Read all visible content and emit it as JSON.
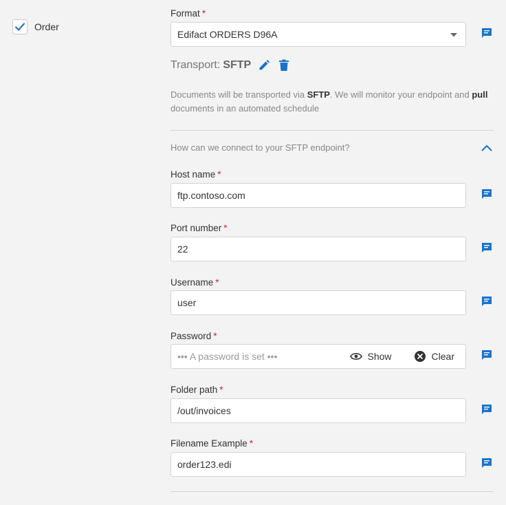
{
  "order": {
    "label": "Order",
    "checked": true
  },
  "format": {
    "label": "Format",
    "value": "Edifact ORDERS D96A"
  },
  "transport": {
    "prefix": "Transport:",
    "type": "SFTP"
  },
  "description": {
    "part1": "Documents will be transported via ",
    "bold1": "SFTP",
    "part2": ". We will monitor your endpoint and ",
    "bold2": "pull",
    "part3": " documents in an automated schedule"
  },
  "connection": {
    "question": "How can we connect to your SFTP endpoint?"
  },
  "fields": {
    "host": {
      "label": "Host name",
      "value": "ftp.contoso.com"
    },
    "port": {
      "label": "Port number",
      "value": "22"
    },
    "username": {
      "label": "Username",
      "value": "user"
    },
    "password": {
      "label": "Password",
      "placeholder": "••• A password is set •••",
      "show_label": "Show",
      "clear_label": "Clear"
    },
    "folder": {
      "label": "Folder path",
      "value": "/out/invoices"
    },
    "filename": {
      "label": "Filename Example",
      "value": "order123.edi"
    }
  },
  "required_mark": "*",
  "colors": {
    "accent": "#1a73c9",
    "required": "#d32020"
  },
  "icons": {
    "checkbox": "checkmark-icon",
    "comment": "comment-icon",
    "edit": "pencil-icon",
    "delete": "trash-icon",
    "collapse": "chevron-up-icon",
    "show": "eye-icon",
    "clear": "close-circle-icon",
    "dropdown": "caret-down-icon"
  }
}
